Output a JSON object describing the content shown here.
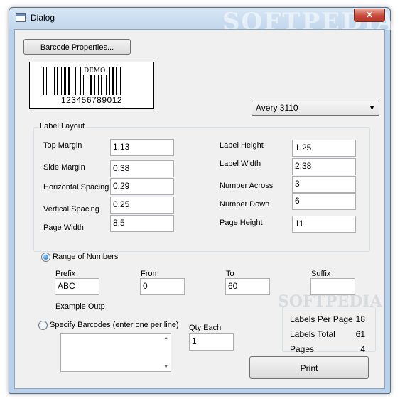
{
  "window": {
    "title": "Dialog",
    "close_glyph": "✕",
    "watermark": "SOFTPEDIA"
  },
  "barcode": {
    "properties_button": "Barcode Properties...",
    "demo_label": "DEMO",
    "number": "123456789012"
  },
  "label_select": {
    "selected": "Avery 3110",
    "arrow_glyph": "▼"
  },
  "layout": {
    "title": "Label Layout",
    "top_margin": {
      "label": "Top Margin",
      "value": "1.13"
    },
    "side_margin": {
      "label": "Side Margin",
      "value": "0.38"
    },
    "horizontal_spacing": {
      "label": "Horizontal Spacing",
      "value": "0.29"
    },
    "vertical_spacing": {
      "label": "Vertical Spacing",
      "value": "0.25"
    },
    "page_width": {
      "label": "Page Width",
      "value": "8.5"
    },
    "label_height": {
      "label": "Label Height",
      "value": "1.25"
    },
    "label_width": {
      "label": "Label Width",
      "value": "2.38"
    },
    "number_across": {
      "label": "Number Across",
      "value": "3"
    },
    "number_down": {
      "label": "Number Down",
      "value": "6"
    },
    "page_height": {
      "label": "Page Height",
      "value": "11"
    }
  },
  "range": {
    "label": "Range of Numbers",
    "selected": true,
    "prefix": {
      "label": "Prefix",
      "value": "ABC"
    },
    "from": {
      "label": "From",
      "value": "0"
    },
    "to": {
      "label": "To",
      "value": "60"
    },
    "suffix": {
      "label": "Suffix",
      "value": ""
    },
    "example_label": "Example Outp"
  },
  "specify": {
    "label": "Specify Barcodes (enter one per line)",
    "selected": false,
    "qty_label": "Qty Each",
    "qty_value": "1",
    "scroll_up": "▲",
    "scroll_down": "▼"
  },
  "stats": {
    "labels_per_page": {
      "label": "Labels Per Page",
      "value": "18"
    },
    "labels_total": {
      "label": "Labels Total",
      "value": "61"
    },
    "pages": {
      "label": "Pages",
      "value": "4"
    }
  },
  "print_button": "Print",
  "watermark_bottom": "SOFTPEDIA",
  "colors": {
    "window_frame": "#b9d1ea",
    "client_bg": "#f0f0f0",
    "close_red": "#c7483a",
    "radio_blue": "#1f6ec2"
  }
}
